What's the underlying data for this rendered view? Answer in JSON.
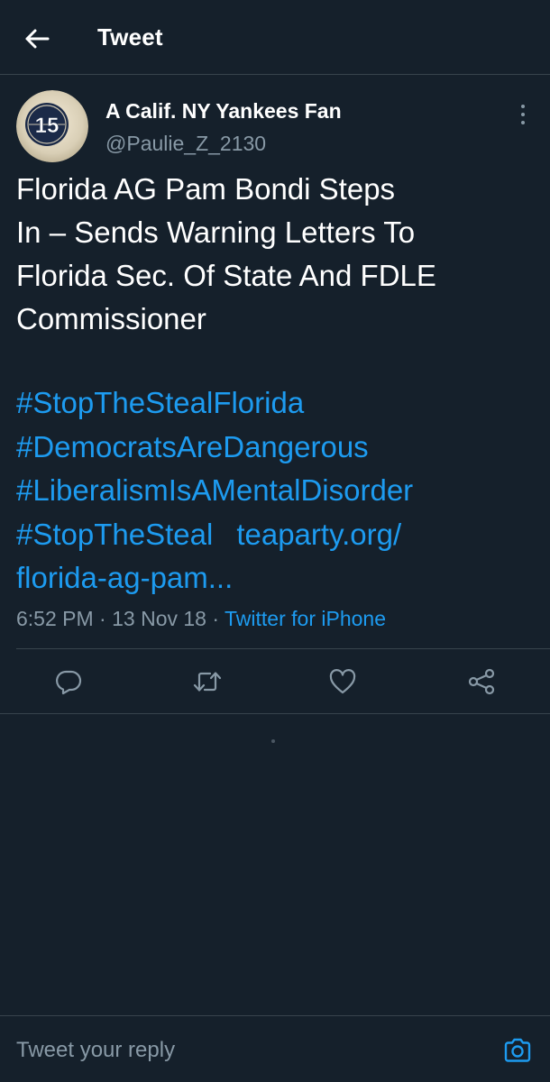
{
  "header": {
    "title": "Tweet",
    "back_icon": "arrow-left-icon"
  },
  "tweet": {
    "author": {
      "name": "A Calif. NY Yankees Fan",
      "handle": "@Paulie_Z_2130",
      "avatar_number": "15"
    },
    "text_lines": [
      "Florida AG Pam Bondi Steps",
      "In – Sends Warning Letters To",
      "Florida Sec. Of State And FDLE",
      "Commissioner"
    ],
    "hashtags": [
      "#StopTheStealFlorida",
      "#DemocratsAreDangerous",
      "#LiberalismIsAMentalDisorder",
      "#StopTheSteal"
    ],
    "link_line1": "teaparty.org/",
    "link_line2": "florida-ag-pam...",
    "time": "6:52 PM",
    "date": "13 Nov 18",
    "separator": "·",
    "source": "Twitter for iPhone"
  },
  "actions": {
    "reply_icon": "reply-icon",
    "retweet_icon": "retweet-icon",
    "like_icon": "heart-icon",
    "share_icon": "share-icon"
  },
  "reply": {
    "placeholder": "Tweet your reply",
    "camera_icon": "camera-icon"
  },
  "colors": {
    "background": "#15202b",
    "accent": "#1d9bf0",
    "secondary_text": "#8899a6",
    "divider": "#38444d"
  }
}
